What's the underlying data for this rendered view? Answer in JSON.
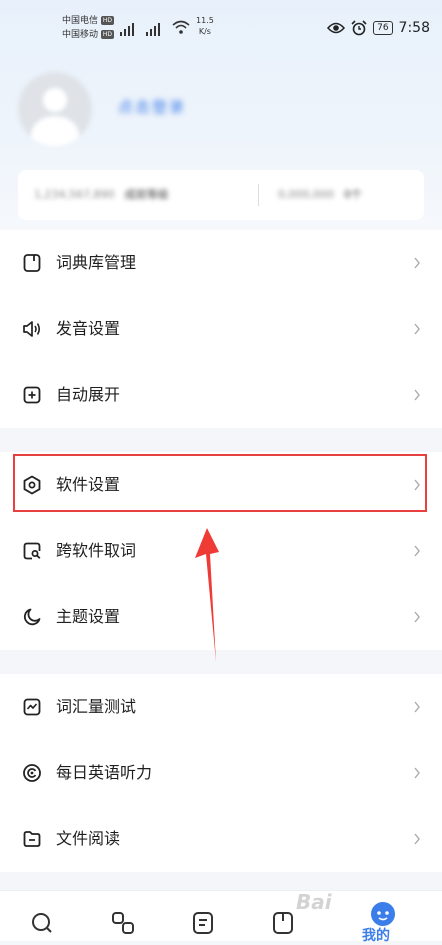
{
  "status_bar": {
    "carrier1": "中国电信",
    "carrier2": "中国移动",
    "hd_badge": "HD",
    "net_speed_value": "11.5",
    "net_speed_unit": "K/s",
    "battery": "76",
    "time": "7:58"
  },
  "profile": {
    "login_text": "点击登录"
  },
  "stats": [
    {
      "label": "1,234,567,890",
      "value": "成就等级"
    },
    {
      "label": "0,000,000",
      "value": "0个"
    }
  ],
  "menu_groups": [
    [
      {
        "label": "词典库管理",
        "icon": "dictionary-icon"
      },
      {
        "label": "发音设置",
        "icon": "speaker-icon"
      },
      {
        "label": "自动展开",
        "icon": "plus-box-icon"
      }
    ],
    [
      {
        "label": "软件设置",
        "icon": "hexagon-settings-icon"
      },
      {
        "label": "跨软件取词",
        "icon": "search-box-icon"
      },
      {
        "label": "主题设置",
        "icon": "moon-icon"
      }
    ],
    [
      {
        "label": "词汇量测试",
        "icon": "chart-box-icon"
      },
      {
        "label": "每日英语听力",
        "icon": "headphone-circle-icon"
      },
      {
        "label": "文件阅读",
        "icon": "folder-icon"
      }
    ]
  ],
  "bottom_nav": {
    "active_label": "我的",
    "items": [
      "search-icon",
      "translate-icon",
      "notes-icon",
      "book-icon",
      "profile-icon"
    ]
  },
  "watermark": "Bai",
  "colors": {
    "accent": "#3b7de9",
    "highlight": "#e8403f",
    "text": "#1f1f1f"
  }
}
